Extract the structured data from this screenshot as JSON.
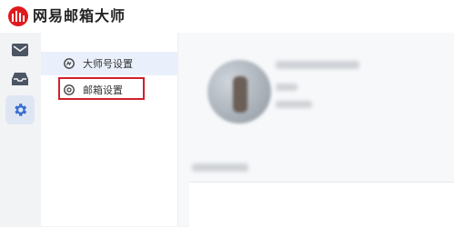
{
  "app": {
    "title": "网易邮箱大师",
    "brand_color": "#e0191f"
  },
  "rail": [
    {
      "name": "mail",
      "icon": "envelope-icon",
      "active": false
    },
    {
      "name": "inbox",
      "icon": "inbox-tray-icon",
      "active": false
    },
    {
      "name": "settings",
      "icon": "gear-icon",
      "active": true
    }
  ],
  "settings_menu": {
    "items": [
      {
        "label": "大师号设置",
        "icon": "master-account-icon",
        "active": true
      },
      {
        "label": "邮箱设置",
        "icon": "settings-circle-icon",
        "active": false,
        "highlighted": true
      }
    ]
  },
  "colors": {
    "active_rail": "#dfe6f3",
    "active_menu": "#eaf0fb",
    "accent": "#3b6fd1",
    "highlight_box": "#d0202a"
  }
}
